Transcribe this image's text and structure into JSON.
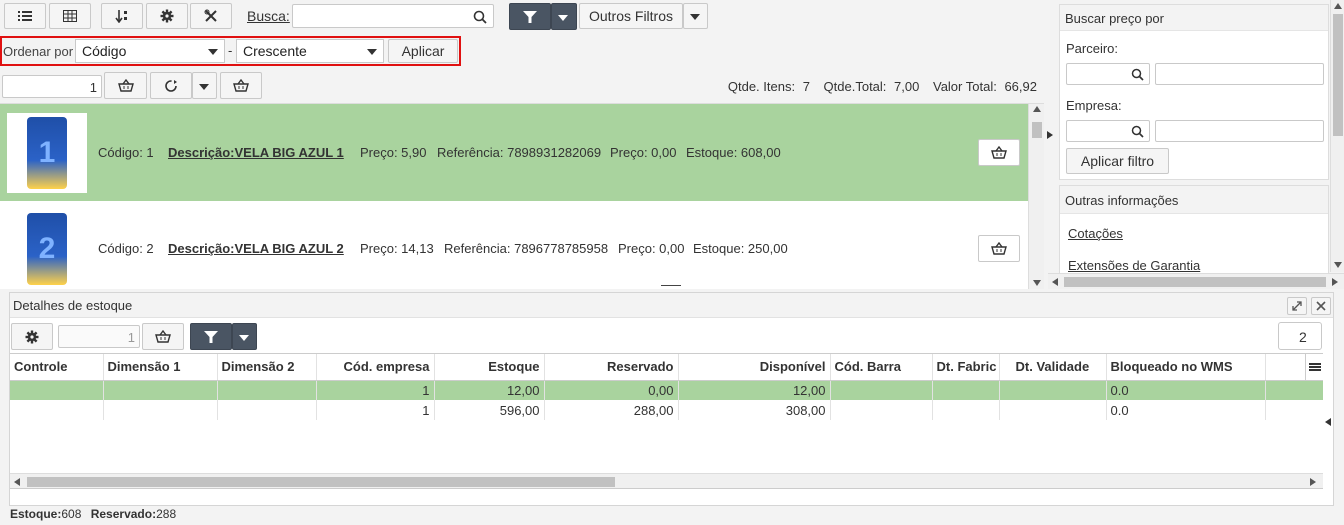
{
  "toolbar": {
    "busca_label": "Busca:",
    "busca_value": "",
    "outros_filtros_label": "Outros Filtros"
  },
  "sort": {
    "ordenar_label": "Ordenar por",
    "field_value": "Código",
    "separator": "-",
    "direction_value": "Crescente",
    "apply_label": "Aplicar"
  },
  "summary": {
    "quantity_value": "1",
    "qtde_itens_label": "Qtde. Itens:",
    "qtde_itens_value": "7",
    "qtde_total_label": "Qtde.Total:",
    "qtde_total_value": "7,00",
    "valor_total_label": "Valor Total:",
    "valor_total_value": "66,92"
  },
  "products": [
    {
      "codigo": "Código: 1",
      "descricao": "Descrição:VELA BIG AZUL 1",
      "preco": "Preço: 5,90",
      "referencia": "Referência: 7898931282069",
      "preco2": "Preço: 0,00",
      "estoque": "Estoque: 608,00",
      "digit": "1"
    },
    {
      "codigo": "Código: 2",
      "descricao": "Descrição:VELA BIG AZUL 2",
      "preco": "Preço: 14,13",
      "referencia": "Referência: 7896778785958",
      "preco2": "Preço: 0,00",
      "estoque": "Estoque: 250,00",
      "digit": "2"
    }
  ],
  "right_panel": {
    "buscar_title": "Buscar preço por",
    "parceiro_label": "Parceiro:",
    "empresa_label": "Empresa:",
    "aplicar_filtro_label": "Aplicar filtro",
    "outras_title": "Outras informações",
    "links": [
      "Cotações",
      "Extensões de Garantia"
    ]
  },
  "stock": {
    "title": "Detalhes de estoque",
    "quantity_value": "1",
    "page_value": "2",
    "columns": [
      "Controle",
      "Dimensão 1",
      "Dimensão 2",
      "Cód. empresa",
      "Estoque",
      "Reservado",
      "Disponível",
      "Cód. Barra",
      "Dt. Fabric",
      "Dt. Validade",
      "Bloqueado no WMS"
    ],
    "rows": [
      [
        "",
        "",
        "",
        "1",
        "12,00",
        "0,00",
        "12,00",
        "",
        "",
        "",
        "0.0"
      ],
      [
        "",
        "",
        "",
        "1",
        "596,00",
        "288,00",
        "308,00",
        "",
        "",
        "",
        "0.0"
      ]
    ],
    "footer_estoque_label": "Estoque:",
    "footer_estoque_value": "608",
    "footer_reservado_label": "Reservado:",
    "footer_reservado_value": "288"
  },
  "colors": {
    "selected_row": "#a9d39e",
    "highlight_border": "#e01010",
    "dark_button": "#4a5563"
  }
}
